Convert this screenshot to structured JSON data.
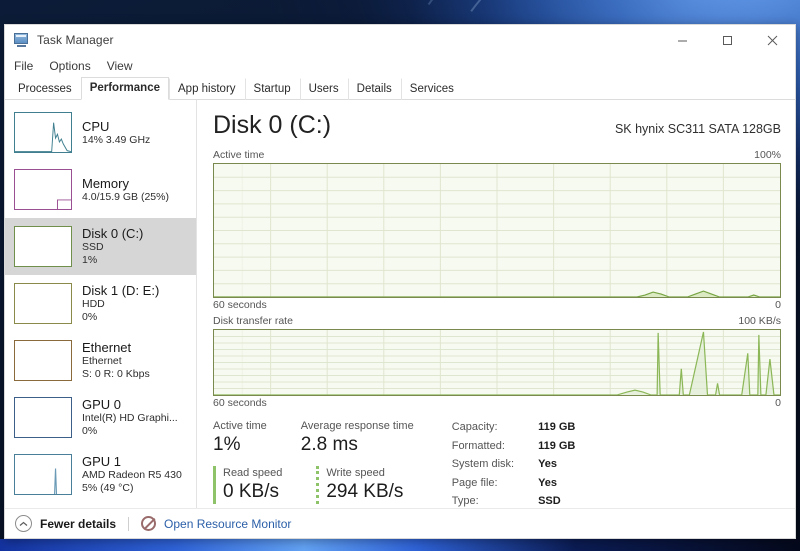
{
  "window": {
    "title": "Task Manager",
    "icon": "task-manager-icon",
    "buttons": {
      "minimize": "minimize-icon",
      "maximize": "maximize-icon",
      "close": "close-icon"
    }
  },
  "menubar": {
    "items": [
      "File",
      "Options",
      "View"
    ]
  },
  "tabs": [
    {
      "label": "Processes",
      "active": false
    },
    {
      "label": "Performance",
      "active": true
    },
    {
      "label": "App history",
      "active": false
    },
    {
      "label": "Startup",
      "active": false
    },
    {
      "label": "Users",
      "active": false
    },
    {
      "label": "Details",
      "active": false
    },
    {
      "label": "Services",
      "active": false
    }
  ],
  "sidebar": {
    "items": [
      {
        "title": "CPU",
        "sub1": "14% 3.49 GHz",
        "sub2": "",
        "color": "#3f7f8f",
        "selected": false
      },
      {
        "title": "Memory",
        "sub1": "4.0/15.9 GB (25%)",
        "sub2": "",
        "color": "#9a4f93",
        "selected": false
      },
      {
        "title": "Disk 0 (C:)",
        "sub1": "SSD",
        "sub2": "1%",
        "color": "#6f8f4a",
        "selected": true
      },
      {
        "title": "Disk 1 (D: E:)",
        "sub1": "HDD",
        "sub2": "0%",
        "color": "#8a8a4a",
        "selected": false
      },
      {
        "title": "Ethernet",
        "sub1": "Ethernet",
        "sub2": "S: 0 R: 0 Kbps",
        "color": "#8a6a3a",
        "selected": false
      },
      {
        "title": "GPU 0",
        "sub1": "Intel(R) HD Graphi...",
        "sub2": "0%",
        "color": "#3c5f8a",
        "selected": false
      },
      {
        "title": "GPU 1",
        "sub1": "AMD Radeon R5 430",
        "sub2": "5%  (49 °C)",
        "color": "#4a7f9a",
        "selected": false
      }
    ]
  },
  "main": {
    "title": "Disk 0 (C:)",
    "device": "SK hynix SC311 SATA 128GB",
    "graph_active": {
      "label": "Active time",
      "max_label": "100%",
      "time_label": "60 seconds",
      "min_label": "0"
    },
    "graph_transfer": {
      "label": "Disk transfer rate",
      "max_label": "100 KB/s",
      "time_label": "60 seconds",
      "min_label": "0"
    },
    "stats": {
      "active_time_label": "Active time",
      "active_time_value": "1%",
      "avg_response_label": "Average response time",
      "avg_response_value": "2.8 ms",
      "read_speed_label": "Read speed",
      "read_speed_value": "0 KB/s",
      "write_speed_label": "Write speed",
      "write_speed_value": "294 KB/s",
      "details": [
        {
          "key": "Capacity:",
          "value": "119 GB"
        },
        {
          "key": "Formatted:",
          "value": "119 GB"
        },
        {
          "key": "System disk:",
          "value": "Yes"
        },
        {
          "key": "Page file:",
          "value": "Yes"
        },
        {
          "key": "Type:",
          "value": "SSD"
        }
      ]
    }
  },
  "statusbar": {
    "fewer_details": "Fewer details",
    "open_resource_monitor": "Open Resource Monitor"
  },
  "chart_data": [
    {
      "type": "area",
      "title": "Active time",
      "ylabel": "%",
      "ylim": [
        0,
        100
      ],
      "xlabel": "60 seconds",
      "grid": true,
      "accent": "#77a544",
      "x": [
        0,
        5,
        10,
        15,
        20,
        25,
        30,
        35,
        40,
        45,
        50,
        55,
        58,
        60,
        62,
        64,
        66,
        68,
        70,
        72,
        74,
        76,
        78,
        80,
        82,
        84,
        86,
        88,
        90,
        92,
        94,
        96,
        98,
        100
      ],
      "values": [
        0,
        0,
        0,
        0,
        0,
        0,
        0,
        0,
        0,
        0,
        0,
        0,
        0,
        0,
        0,
        0,
        0,
        0,
        0,
        0,
        0,
        0,
        2,
        3,
        2,
        0,
        0,
        2,
        3,
        2,
        0,
        0,
        1,
        0
      ]
    },
    {
      "type": "area",
      "title": "Disk transfer rate",
      "ylabel": "KB/s",
      "ylim": [
        0,
        100
      ],
      "xlabel": "60 seconds",
      "grid": true,
      "accent": "#77a544",
      "x": [
        0,
        40,
        60,
        70,
        74,
        76,
        78,
        80,
        82,
        84,
        86,
        88,
        90,
        92,
        94,
        96,
        98,
        100
      ],
      "values": [
        0,
        0,
        0,
        0,
        4,
        6,
        3,
        0,
        96,
        0,
        70,
        0,
        100,
        0,
        0,
        62,
        0,
        95
      ]
    }
  ]
}
